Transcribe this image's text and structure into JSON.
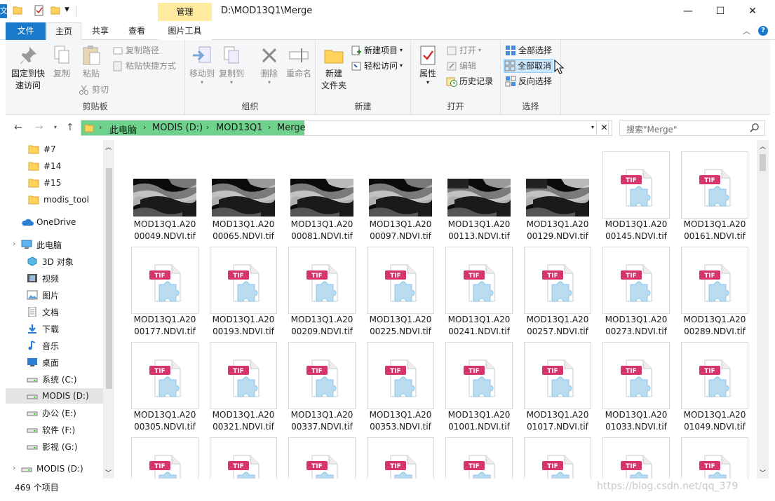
{
  "titlebar": {
    "path": "D:\\MOD13Q1\\Merge",
    "context_tab": "管理",
    "edge_char": "文",
    "minimize": "—",
    "maximize": "☐",
    "close": "✕"
  },
  "tabs": {
    "file": "文件",
    "home": "主页",
    "share": "共享",
    "view": "查看",
    "picture_tools": "图片工具",
    "help": "?"
  },
  "ribbon": {
    "clipboard": {
      "label": "剪贴板",
      "pin_line1": "固定到快",
      "pin_line2": "速访问",
      "copy": "复制",
      "paste": "粘贴",
      "copy_path": "复制路径",
      "paste_shortcut": "粘贴快捷方式",
      "cut": "剪切"
    },
    "organize": {
      "label": "组织",
      "move_to": "移动到",
      "copy_to": "复制到",
      "delete": "删除",
      "rename": "重命名"
    },
    "new": {
      "label": "新建",
      "new_folder_line1": "新建",
      "new_folder_line2": "文件夹",
      "new_item": "新建项目",
      "easy_access": "轻松访问"
    },
    "open": {
      "label": "打开",
      "properties": "属性",
      "open": "打开",
      "edit": "编辑",
      "history": "历史记录"
    },
    "select": {
      "label": "选择",
      "select_all": "全部选择",
      "select_none": "全部取消",
      "invert": "反向选择"
    }
  },
  "address": {
    "crumbs": [
      "此电脑",
      "MODIS (D:)",
      "MOD13Q1",
      "Merge"
    ],
    "search_placeholder": "搜索\"Merge\""
  },
  "navpane": {
    "items": [
      {
        "label": "#7",
        "icon": "folder-icon"
      },
      {
        "label": "#14",
        "icon": "folder-icon"
      },
      {
        "label": "#15",
        "icon": "folder-icon"
      },
      {
        "label": "modis_tool",
        "icon": "folder-icon"
      },
      {
        "label": "OneDrive",
        "icon": "cloud-icon"
      },
      {
        "label": "此电脑",
        "icon": "computer-icon"
      },
      {
        "label": "3D 对象",
        "icon": "3d-objects-icon"
      },
      {
        "label": "视频",
        "icon": "video-icon"
      },
      {
        "label": "图片",
        "icon": "pictures-icon"
      },
      {
        "label": "文档",
        "icon": "documents-icon"
      },
      {
        "label": "下载",
        "icon": "download-icon"
      },
      {
        "label": "音乐",
        "icon": "music-icon"
      },
      {
        "label": "桌面",
        "icon": "desktop-icon"
      },
      {
        "label": "系统 (C:)",
        "icon": "drive-icon"
      },
      {
        "label": "MODIS (D:)",
        "icon": "drive-icon"
      },
      {
        "label": "办公 (E:)",
        "icon": "drive-icon"
      },
      {
        "label": "软件 (F:)",
        "icon": "drive-icon"
      },
      {
        "label": "影视 (G:)",
        "icon": "drive-icon"
      },
      {
        "label": "MODIS (D:)",
        "icon": "drive-icon"
      }
    ]
  },
  "files": [
    {
      "line1": "MOD13Q1.A20",
      "line2": "00049.NDVI.tif",
      "thumb": true
    },
    {
      "line1": "MOD13Q1.A20",
      "line2": "00065.NDVI.tif",
      "thumb": true
    },
    {
      "line1": "MOD13Q1.A20",
      "line2": "00081.NDVI.tif",
      "thumb": true
    },
    {
      "line1": "MOD13Q1.A20",
      "line2": "00097.NDVI.tif",
      "thumb": true
    },
    {
      "line1": "MOD13Q1.A20",
      "line2": "00113.NDVI.tif",
      "thumb": true
    },
    {
      "line1": "MOD13Q1.A20",
      "line2": "00129.NDVI.tif",
      "thumb": true
    },
    {
      "line1": "MOD13Q1.A20",
      "line2": "00145.NDVI.tif",
      "thumb": false
    },
    {
      "line1": "MOD13Q1.A20",
      "line2": "00161.NDVI.tif",
      "thumb": false
    },
    {
      "line1": "MOD13Q1.A20",
      "line2": "00177.NDVI.tif",
      "thumb": false
    },
    {
      "line1": "MOD13Q1.A20",
      "line2": "00193.NDVI.tif",
      "thumb": false
    },
    {
      "line1": "MOD13Q1.A20",
      "line2": "00209.NDVI.tif",
      "thumb": false
    },
    {
      "line1": "MOD13Q1.A20",
      "line2": "00225.NDVI.tif",
      "thumb": false
    },
    {
      "line1": "MOD13Q1.A20",
      "line2": "00241.NDVI.tif",
      "thumb": false
    },
    {
      "line1": "MOD13Q1.A20",
      "line2": "00257.NDVI.tif",
      "thumb": false
    },
    {
      "line1": "MOD13Q1.A20",
      "line2": "00273.NDVI.tif",
      "thumb": false
    },
    {
      "line1": "MOD13Q1.A20",
      "line2": "00289.NDVI.tif",
      "thumb": false
    },
    {
      "line1": "MOD13Q1.A20",
      "line2": "00305.NDVI.tif",
      "thumb": false
    },
    {
      "line1": "MOD13Q1.A20",
      "line2": "00321.NDVI.tif",
      "thumb": false
    },
    {
      "line1": "MOD13Q1.A20",
      "line2": "00337.NDVI.tif",
      "thumb": false
    },
    {
      "line1": "MOD13Q1.A20",
      "line2": "00353.NDVI.tif",
      "thumb": false
    },
    {
      "line1": "MOD13Q1.A20",
      "line2": "01001.NDVI.tif",
      "thumb": false
    },
    {
      "line1": "MOD13Q1.A20",
      "line2": "01017.NDVI.tif",
      "thumb": false
    },
    {
      "line1": "MOD13Q1.A20",
      "line2": "01033.NDVI.tif",
      "thumb": false
    },
    {
      "line1": "MOD13Q1.A20",
      "line2": "01049.NDVI.tif",
      "thumb": false
    },
    {
      "line1": "",
      "line2": "",
      "thumb": false
    },
    {
      "line1": "",
      "line2": "",
      "thumb": false
    },
    {
      "line1": "",
      "line2": "",
      "thumb": false
    },
    {
      "line1": "",
      "line2": "",
      "thumb": false
    },
    {
      "line1": "",
      "line2": "",
      "thumb": false
    },
    {
      "line1": "",
      "line2": "",
      "thumb": false
    },
    {
      "line1": "",
      "line2": "",
      "thumb": false
    },
    {
      "line1": "",
      "line2": "",
      "thumb": false
    }
  ],
  "tif_badge": "TIF",
  "status": {
    "item_count": "469 个项目"
  },
  "watermark": "https://blog.csdn.net/qq_379"
}
